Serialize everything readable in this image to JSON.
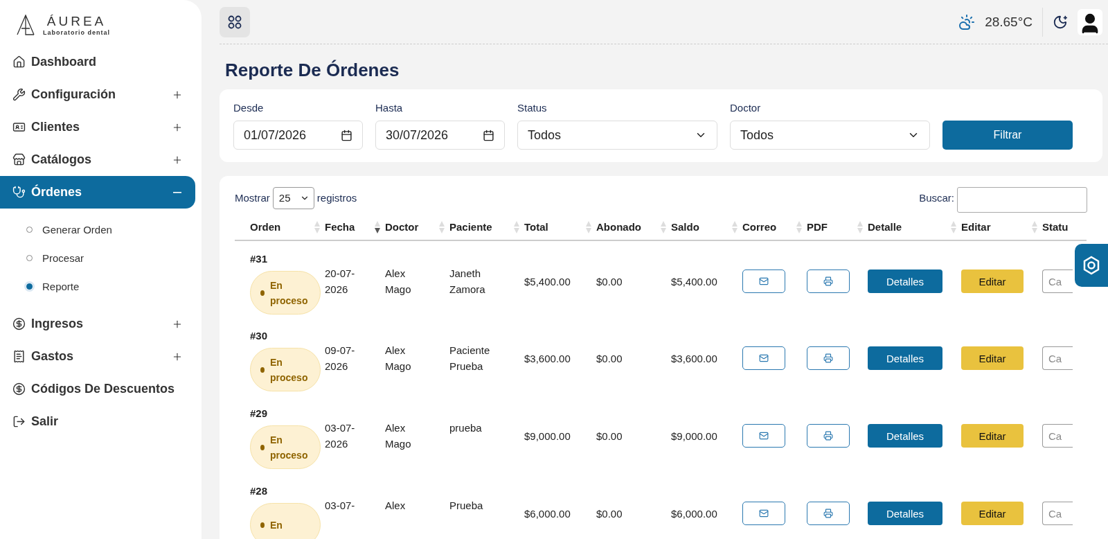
{
  "brand": {
    "name": "ÁUREA",
    "tagline": "Laboratorio dental"
  },
  "sidebar": {
    "items": [
      {
        "label": "Dashboard",
        "kind": "link",
        "selected": false
      },
      {
        "label": "Configuración",
        "kind": "group",
        "expanded": false,
        "selected": false
      },
      {
        "label": "Clientes",
        "kind": "group",
        "expanded": false,
        "selected": false
      },
      {
        "label": "Catálogos",
        "kind": "group",
        "expanded": false,
        "selected": false
      },
      {
        "label": "Órdenes",
        "kind": "group",
        "expanded": true,
        "selected": true,
        "children": [
          {
            "label": "Generar Orden",
            "selected": false
          },
          {
            "label": "Procesar",
            "selected": false
          },
          {
            "label": "Reporte",
            "selected": true
          }
        ]
      },
      {
        "label": "Ingresos",
        "kind": "group",
        "expanded": false,
        "selected": false
      },
      {
        "label": "Gastos",
        "kind": "group",
        "expanded": false,
        "selected": false
      },
      {
        "label": "Códigos De Descuentos",
        "kind": "link",
        "selected": false
      },
      {
        "label": "Salir",
        "kind": "link",
        "selected": false
      }
    ]
  },
  "topbar": {
    "temperature": "28.65°C"
  },
  "page": {
    "title": "Reporte De Órdenes"
  },
  "filters": {
    "fields": [
      {
        "label": "Desde",
        "kind": "date",
        "value": "01/07/2026"
      },
      {
        "label": "Hasta",
        "kind": "date",
        "value": "30/07/2026"
      },
      {
        "label": "Status",
        "kind": "select",
        "value": "Todos"
      },
      {
        "label": "Doctor",
        "kind": "select",
        "value": "Todos"
      }
    ],
    "button": "Filtrar"
  },
  "table": {
    "length_label_before": "Mostrar",
    "length_value": "25",
    "length_label_after": "registros",
    "search_label": "Buscar:",
    "columns": [
      {
        "label": "Orden",
        "sorted": false
      },
      {
        "label": "Fecha",
        "sorted": true
      },
      {
        "label": "Doctor",
        "sorted": false
      },
      {
        "label": "Paciente",
        "sorted": false
      },
      {
        "label": "Total",
        "sorted": false
      },
      {
        "label": "Abonado",
        "sorted": false
      },
      {
        "label": "Saldo",
        "sorted": false
      },
      {
        "label": "Correo",
        "sorted": false
      },
      {
        "label": "PDF",
        "sorted": false
      },
      {
        "label": "Detalle",
        "sorted": false
      },
      {
        "label": "Editar",
        "sorted": false
      },
      {
        "label": "Statu"
      }
    ],
    "rows": [
      {
        "orden": "#31",
        "status": "En proceso",
        "fecha": "20-07-2026",
        "doctor": "Alex Mago",
        "paciente": "Janeth Zamora",
        "total": "$5,400.00",
        "abonado": "$0.00",
        "saldo": "$5,400.00",
        "detalle": "Detalles",
        "editar": "Editar",
        "status_button": "Ca"
      },
      {
        "orden": "#30",
        "status": "En proceso",
        "fecha": "09-07-2026",
        "doctor": "Alex Mago",
        "paciente": "Paciente Prueba",
        "total": "$3,600.00",
        "abonado": "$0.00",
        "saldo": "$3,600.00",
        "detalle": "Detalles",
        "editar": "Editar",
        "status_button": "Ca"
      },
      {
        "orden": "#29",
        "status": "En proceso",
        "fecha": "03-07-2026",
        "doctor": "Alex Mago",
        "paciente": "prueba",
        "total": "$9,000.00",
        "abonado": "$0.00",
        "saldo": "$9,000.00",
        "detalle": "Detalles",
        "editar": "Editar",
        "status_button": "Ca"
      },
      {
        "orden": "#28",
        "status": "En",
        "fecha": "03-07-",
        "doctor": "Alex",
        "paciente": "Prueba",
        "total": "$6,000.00",
        "abonado": "$0.00",
        "saldo": "$6,000.00",
        "detalle": "Detalles",
        "editar": "Editar",
        "status_button": "Ca"
      }
    ]
  }
}
